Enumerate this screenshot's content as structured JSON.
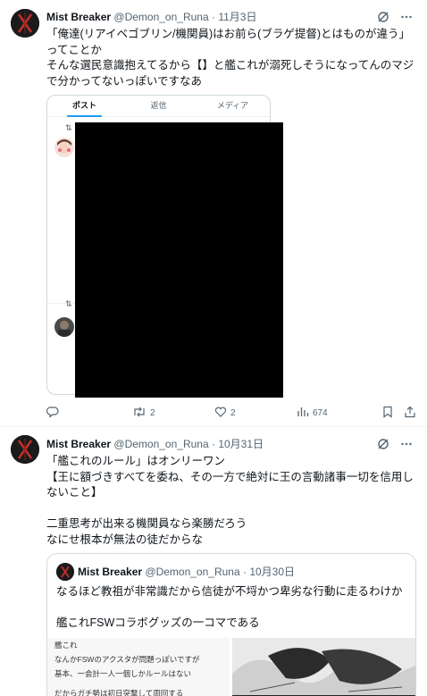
{
  "tweet1": {
    "author_name": "Mist Breaker",
    "handle": "@Demon_on_Runa",
    "separator": "·",
    "date": "11月3日",
    "text": "「俺達(リアイベゴブリン/機関員)はお前ら(ブラゲ提督)とはものが違う」ってことか\nそんな選民意識抱えてるから【】と艦これが溺死しそうになってんのマジで分かってないっぽいですなあ",
    "embed": {
      "tabs": [
        "ポスト",
        "返信",
        "メディア"
      ],
      "retweet_marks": [
        "⇅",
        "⇅"
      ]
    },
    "stats": {
      "retweets": "2",
      "likes": "2",
      "views": "674"
    }
  },
  "tweet2": {
    "author_name": "Mist Breaker",
    "handle": "@Demon_on_Runa",
    "separator": "·",
    "date": "10月31日",
    "text": "「艦これのルール」はオンリーワン\n【王に額づきすべてを委ね、その一方で絶対に王の言動諸事一切を信用しないこと】\n\n二重思考が出来る機関員なら楽勝だろう\nなにせ根本が無法の徒だからな",
    "quote": {
      "author_name": "Mist Breaker",
      "handle": "@Demon_on_Runa",
      "separator": "·",
      "date": "10月30日",
      "text": "なるほど教祖が非常識だから信徒が不埒かつ卑劣な行動に走るわけか\n\n艦これFSWコラボグッズの一コマである",
      "image_lines": [
        "艦これ",
        "なんかFSWのアクスタが問題っぽいですが",
        "基本、一会計一人一個しかルールはない",
        "だからガチ勢は初日突撃して周回する"
      ]
    }
  },
  "colors": {
    "accent": "#1d9bf0",
    "muted": "#536471",
    "border": "#cfd9de"
  },
  "icons": [
    "grok-icon",
    "more-icon",
    "reply-icon",
    "retweet-icon",
    "like-icon",
    "views-icon",
    "bookmark-icon",
    "share-icon"
  ]
}
